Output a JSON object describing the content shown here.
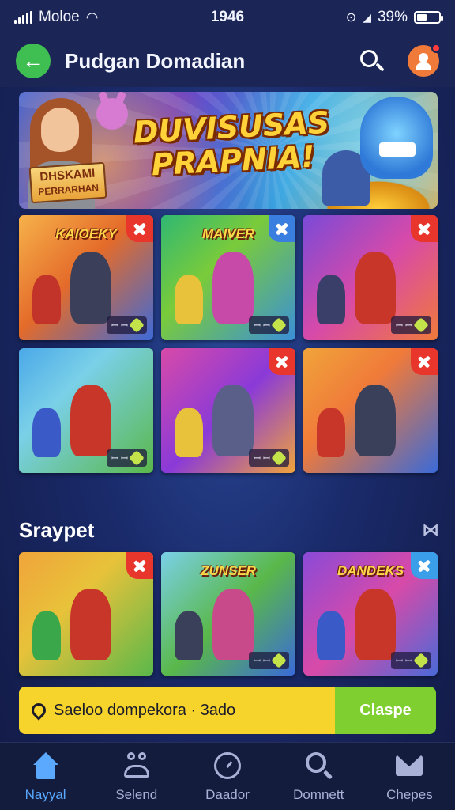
{
  "status_bar": {
    "carrier": "Moloe",
    "time": "1946",
    "battery": "39%"
  },
  "header": {
    "title": "Pudgan Domadian"
  },
  "hero": {
    "title_line1": "DUVISUSAS",
    "title_line2": "PRAPNIA!",
    "sign_line1": "DHSKAMI",
    "sign_line2": "PERRARHAN"
  },
  "grid_cards": [
    {
      "title": "KAIOEKY",
      "chip": "ꟷ ꟷ",
      "bg": "linear-gradient(135deg,#f6b24a 0%,#e46b2a 45%,#3d6ad8 100%)",
      "badge": "#e8362c",
      "fig": "#3b3f5a",
      "fig2": "#c2332a"
    },
    {
      "title": "MAIVER",
      "chip": "ꟷ ꟷ",
      "bg": "linear-gradient(135deg,#2fb873 0%,#7acb3a 40%,#3a8fd8 100%)",
      "badge": "#3a7fe0",
      "fig": "#c84aa8",
      "fig2": "#e8c23a"
    },
    {
      "title": "",
      "chip": "ꟷ ꟷ",
      "bg": "linear-gradient(135deg,#7a4ad8 0%,#d84aa8 50%,#f07a3a 100%)",
      "badge": "#e8362c",
      "fig": "#c8362a",
      "fig2": "#3a3f6a"
    },
    {
      "title": "",
      "chip": "ꟷ ꟷ",
      "bg": "linear-gradient(135deg,#4aa8e8 0%,#7ad0e8 35%,#5ab84a 100%)",
      "badge": "",
      "fig": "#c8362a",
      "fig2": "#3a5ac8"
    },
    {
      "title": "",
      "chip": "ꟷ ꟷ",
      "bg": "linear-gradient(135deg,#d84aa8 0%,#8a3ad8 50%,#f0a43a 100%)",
      "badge": "#e8362c",
      "fig": "#5a5f8a",
      "fig2": "#e8c23a"
    },
    {
      "title": "",
      "chip": "",
      "bg": "linear-gradient(135deg,#f0a43a 0%,#f07a3a 40%,#3a6ad8 100%)",
      "badge": "#e8362c",
      "fig": "#3a3f5a",
      "fig2": "#c8362a"
    }
  ],
  "section": {
    "title": "Sraypet",
    "more": "⋈"
  },
  "grid2_cards": [
    {
      "title": "",
      "chip": "",
      "bg": "linear-gradient(135deg,#f0a43a 0%,#e8c23a 40%,#5ab84a 100%)",
      "badge": "#e8362c",
      "fig": "#c8362a",
      "fig2": "#3aa84a"
    },
    {
      "title": "ZUNSER",
      "chip": "ꟷ ꟷ",
      "bg": "linear-gradient(135deg,#7ad0e8 0%,#5ab84a 50%,#3a6ad8 100%)",
      "badge": "",
      "fig": "#c84a8a",
      "fig2": "#3a3f5a"
    },
    {
      "title": "DANDEKS",
      "chip": "ꟷ ꟷ",
      "bg": "linear-gradient(135deg,#8a4ad8 0%,#d84aa8 50%,#4a6ad8 100%)",
      "badge": "#3a9fe8",
      "fig": "#c8362a",
      "fig2": "#3a5ac8"
    }
  ],
  "cta": {
    "text": "Saeloo dompekora · 3ado",
    "button": "Claspe"
  },
  "nav": [
    {
      "label": "Nayyal",
      "icon": "home-icon",
      "active": true
    },
    {
      "label": "Selend",
      "icon": "people-icon",
      "active": false
    },
    {
      "label": "Daador",
      "icon": "clock-icon",
      "active": false
    },
    {
      "label": "Domnett",
      "icon": "search-icon",
      "active": false
    },
    {
      "label": "Chepes",
      "icon": "mail-icon",
      "active": false
    }
  ]
}
